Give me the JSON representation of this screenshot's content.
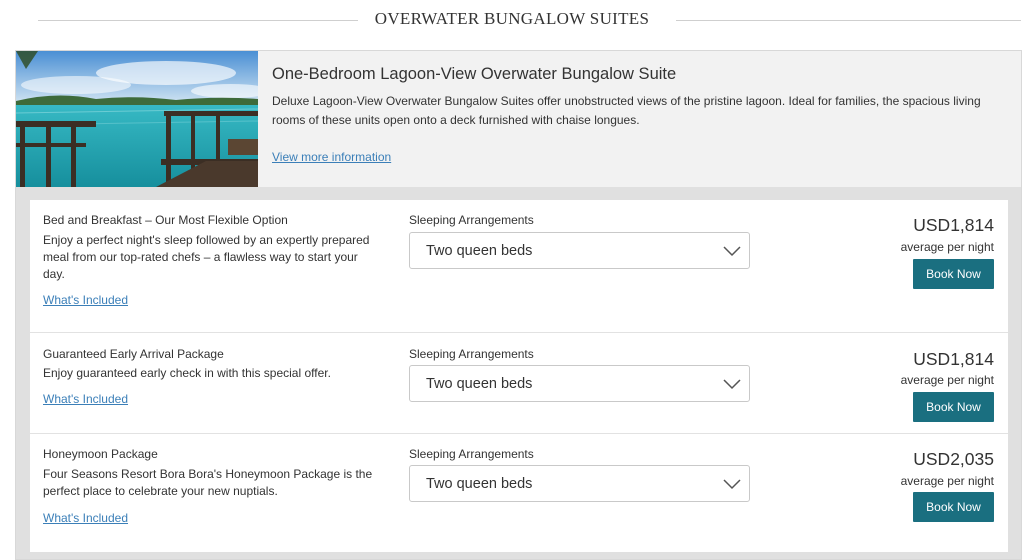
{
  "section": {
    "title": "OVERWATER BUNGALOW SUITES"
  },
  "suite": {
    "title": "One-Bedroom Lagoon-View Overwater Bungalow Suite",
    "description": "Deluxe Lagoon-View Overwater Bungalow Suites offer unobstructed views of the pristine lagoon. Ideal for families, the spacious living rooms of these units open onto a deck furnished with chaise longues.",
    "view_more": "View more information"
  },
  "rates": [
    {
      "name": "Bed and Breakfast – Our Most Flexible Option",
      "description": "Enjoy a perfect night's sleep followed by an expertly prepared meal from our top-rated chefs – a flawless way to start your day.",
      "whats_included": "What's Included",
      "sleeping_label": "Sleeping Arrangements",
      "sleeping_value": "Two queen beds",
      "price": "USD1,814",
      "per_night": "average per night",
      "book": "Book Now"
    },
    {
      "name": "Guaranteed Early Arrival Package",
      "description": "Enjoy guaranteed early check in with this special offer.",
      "whats_included": "What's Included",
      "sleeping_label": "Sleeping Arrangements",
      "sleeping_value": "Two queen beds",
      "price": "USD1,814",
      "per_night": "average per night",
      "book": "Book Now"
    },
    {
      "name": "Honeymoon Package",
      "description": "Four Seasons Resort Bora Bora's Honeymoon Package is the perfect place to celebrate your new nuptials.",
      "whats_included": "What's Included",
      "sleeping_label": "Sleeping Arrangements",
      "sleeping_value": "Two queen beds",
      "price": "USD2,035",
      "per_night": "average per night",
      "book": "Book Now"
    }
  ],
  "colors": {
    "book_button": "#1a6f80",
    "link": "#3b7fb8",
    "card_bg": "#e0e0e0",
    "header_bg": "#f2f2f2"
  },
  "icons": {
    "dropdown": "chevron-down-icon",
    "photo": "lagoon-photo"
  }
}
